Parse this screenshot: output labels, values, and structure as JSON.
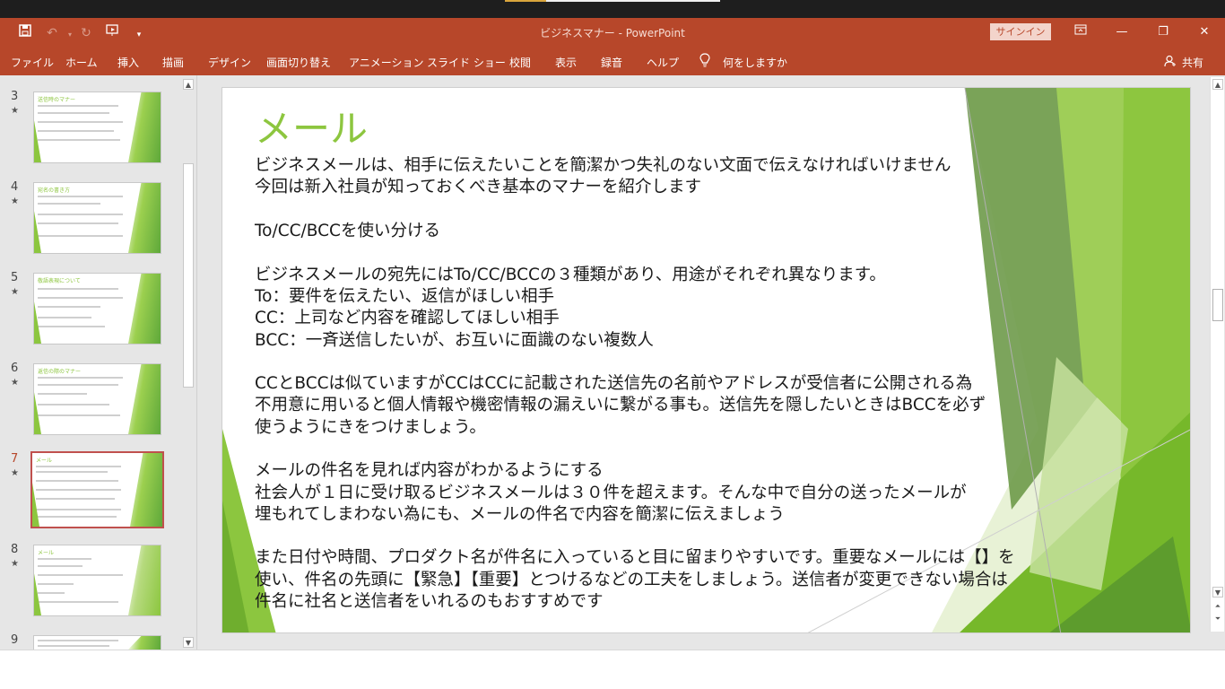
{
  "app": {
    "doc_title": "ビジネスマナー  -  PowerPoint",
    "signin_label": "サインイン",
    "share_label": "共有"
  },
  "ribbon": {
    "tabs": [
      "ファイル",
      "ホーム",
      "挿入",
      "描画",
      "デザイン",
      "画面切り替え",
      "アニメーション",
      "スライド ショー",
      "校閲",
      "表示",
      "録音",
      "ヘルプ"
    ],
    "search_label": "何をしますか"
  },
  "thumbnails": [
    {
      "number": "3",
      "star": "★",
      "title": "送信時のマナー"
    },
    {
      "number": "4",
      "star": "★",
      "title": "宛名の書き方"
    },
    {
      "number": "5",
      "star": "★",
      "title": "敬語表現について"
    },
    {
      "number": "6",
      "star": "★",
      "title": "返信の際のマナー"
    },
    {
      "number": "7",
      "star": "★",
      "title": "メール"
    },
    {
      "number": "8",
      "star": "★",
      "title": "メール"
    },
    {
      "number": "9",
      "star": "",
      "title": ""
    }
  ],
  "slide": {
    "title": "メール",
    "lines": [
      "ビジネスメールは、相手に伝えたいことを簡潔かつ失礼のない文面で伝えなければいけません",
      "今回は新入社員が知っておくべき基本のマナーを紹介します",
      "",
      "To/CC/BCCを使い分ける",
      "",
      "ビジネスメールの宛先にはTo/CC/BCCの３種類があり、用途がそれぞれ異なります。",
      "To：要件を伝えたい、返信がほしい相手",
      "CC：上司など内容を確認してほしい相手",
      "BCC：一斉送信したいが、お互いに面識のない複数人",
      "",
      "CCとBCCは似ていますがCCはCCに記載された送信先の名前やアドレスが受信者に公開される為",
      "不用意に用いると個人情報や機密情報の漏えいに繋がる事も。送信先を隠したいときはBCCを必ず",
      "使うようにきをつけましょう。",
      "",
      "メールの件名を見れば内容がわかるようにする",
      "社会人が１日に受け取るビジネスメールは３０件を超えます。そんな中で自分の送ったメールが",
      "埋もれてしまわない為にも、メールの件名で内容を簡潔に伝えましょう",
      "",
      "また日付や時間、プロダクト名が件名に入っていると目に留まりやすいです。重要なメールには【】を",
      "使い、件名の先頭に【緊急】【重要】とつけるなどの工夫をしましょう。送信者が変更できない場合は",
      "件名に社名と送信者をいれるのもおすすめです"
    ]
  },
  "colors": {
    "title_bar": "#b7472a",
    "accent_green": "#8dc63f",
    "active_thumb_border": "#c0504d"
  }
}
